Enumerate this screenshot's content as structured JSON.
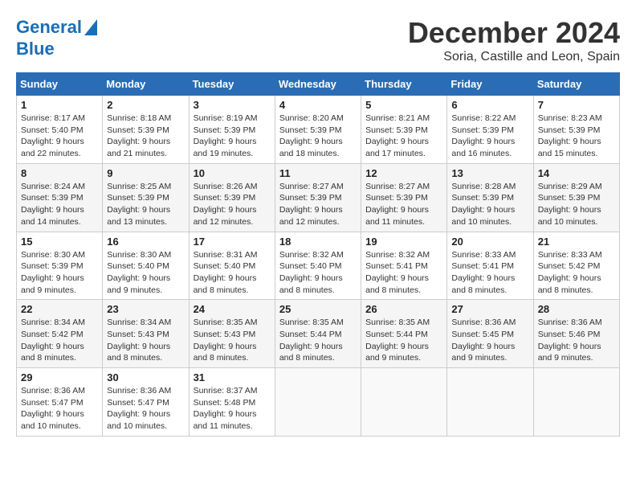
{
  "logo": {
    "line1": "General",
    "line2": "Blue"
  },
  "title": "December 2024",
  "subtitle": "Soria, Castille and Leon, Spain",
  "days_of_week": [
    "Sunday",
    "Monday",
    "Tuesday",
    "Wednesday",
    "Thursday",
    "Friday",
    "Saturday"
  ],
  "weeks": [
    [
      {
        "day": "1",
        "sunrise": "8:17 AM",
        "sunset": "5:40 PM",
        "daylight": "9 hours and 22 minutes."
      },
      {
        "day": "2",
        "sunrise": "8:18 AM",
        "sunset": "5:39 PM",
        "daylight": "9 hours and 21 minutes."
      },
      {
        "day": "3",
        "sunrise": "8:19 AM",
        "sunset": "5:39 PM",
        "daylight": "9 hours and 19 minutes."
      },
      {
        "day": "4",
        "sunrise": "8:20 AM",
        "sunset": "5:39 PM",
        "daylight": "9 hours and 18 minutes."
      },
      {
        "day": "5",
        "sunrise": "8:21 AM",
        "sunset": "5:39 PM",
        "daylight": "9 hours and 17 minutes."
      },
      {
        "day": "6",
        "sunrise": "8:22 AM",
        "sunset": "5:39 PM",
        "daylight": "9 hours and 16 minutes."
      },
      {
        "day": "7",
        "sunrise": "8:23 AM",
        "sunset": "5:39 PM",
        "daylight": "9 hours and 15 minutes."
      }
    ],
    [
      {
        "day": "8",
        "sunrise": "8:24 AM",
        "sunset": "5:39 PM",
        "daylight": "9 hours and 14 minutes."
      },
      {
        "day": "9",
        "sunrise": "8:25 AM",
        "sunset": "5:39 PM",
        "daylight": "9 hours and 13 minutes."
      },
      {
        "day": "10",
        "sunrise": "8:26 AM",
        "sunset": "5:39 PM",
        "daylight": "9 hours and 12 minutes."
      },
      {
        "day": "11",
        "sunrise": "8:27 AM",
        "sunset": "5:39 PM",
        "daylight": "9 hours and 12 minutes."
      },
      {
        "day": "12",
        "sunrise": "8:27 AM",
        "sunset": "5:39 PM",
        "daylight": "9 hours and 11 minutes."
      },
      {
        "day": "13",
        "sunrise": "8:28 AM",
        "sunset": "5:39 PM",
        "daylight": "9 hours and 10 minutes."
      },
      {
        "day": "14",
        "sunrise": "8:29 AM",
        "sunset": "5:39 PM",
        "daylight": "9 hours and 10 minutes."
      }
    ],
    [
      {
        "day": "15",
        "sunrise": "8:30 AM",
        "sunset": "5:39 PM",
        "daylight": "9 hours and 9 minutes."
      },
      {
        "day": "16",
        "sunrise": "8:30 AM",
        "sunset": "5:40 PM",
        "daylight": "9 hours and 9 minutes."
      },
      {
        "day": "17",
        "sunrise": "8:31 AM",
        "sunset": "5:40 PM",
        "daylight": "9 hours and 8 minutes."
      },
      {
        "day": "18",
        "sunrise": "8:32 AM",
        "sunset": "5:40 PM",
        "daylight": "9 hours and 8 minutes."
      },
      {
        "day": "19",
        "sunrise": "8:32 AM",
        "sunset": "5:41 PM",
        "daylight": "9 hours and 8 minutes."
      },
      {
        "day": "20",
        "sunrise": "8:33 AM",
        "sunset": "5:41 PM",
        "daylight": "9 hours and 8 minutes."
      },
      {
        "day": "21",
        "sunrise": "8:33 AM",
        "sunset": "5:42 PM",
        "daylight": "9 hours and 8 minutes."
      }
    ],
    [
      {
        "day": "22",
        "sunrise": "8:34 AM",
        "sunset": "5:42 PM",
        "daylight": "9 hours and 8 minutes."
      },
      {
        "day": "23",
        "sunrise": "8:34 AM",
        "sunset": "5:43 PM",
        "daylight": "9 hours and 8 minutes."
      },
      {
        "day": "24",
        "sunrise": "8:35 AM",
        "sunset": "5:43 PM",
        "daylight": "9 hours and 8 minutes."
      },
      {
        "day": "25",
        "sunrise": "8:35 AM",
        "sunset": "5:44 PM",
        "daylight": "9 hours and 8 minutes."
      },
      {
        "day": "26",
        "sunrise": "8:35 AM",
        "sunset": "5:44 PM",
        "daylight": "9 hours and 9 minutes."
      },
      {
        "day": "27",
        "sunrise": "8:36 AM",
        "sunset": "5:45 PM",
        "daylight": "9 hours and 9 minutes."
      },
      {
        "day": "28",
        "sunrise": "8:36 AM",
        "sunset": "5:46 PM",
        "daylight": "9 hours and 9 minutes."
      }
    ],
    [
      {
        "day": "29",
        "sunrise": "8:36 AM",
        "sunset": "5:47 PM",
        "daylight": "9 hours and 10 minutes."
      },
      {
        "day": "30",
        "sunrise": "8:36 AM",
        "sunset": "5:47 PM",
        "daylight": "9 hours and 10 minutes."
      },
      {
        "day": "31",
        "sunrise": "8:37 AM",
        "sunset": "5:48 PM",
        "daylight": "9 hours and 11 minutes."
      },
      null,
      null,
      null,
      null
    ]
  ],
  "labels": {
    "sunrise": "Sunrise:",
    "sunset": "Sunset:",
    "daylight": "Daylight:"
  }
}
